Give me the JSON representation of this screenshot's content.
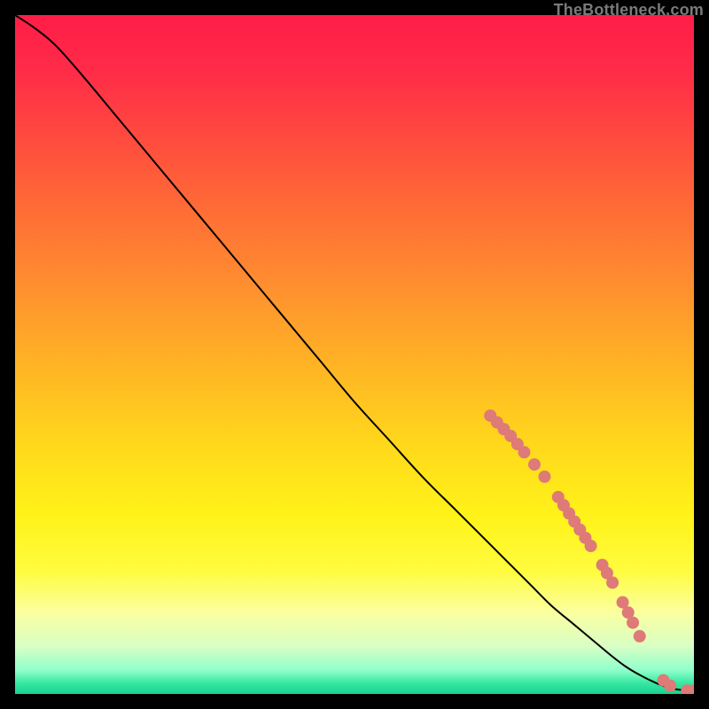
{
  "attribution": "TheBottleneck.com",
  "colors": {
    "gradient_stops": [
      {
        "offset": 0.0,
        "color": "#ff1d47"
      },
      {
        "offset": 0.08,
        "color": "#ff2b48"
      },
      {
        "offset": 0.18,
        "color": "#ff4a3f"
      },
      {
        "offset": 0.28,
        "color": "#ff6a36"
      },
      {
        "offset": 0.4,
        "color": "#ff8f2f"
      },
      {
        "offset": 0.52,
        "color": "#ffb524"
      },
      {
        "offset": 0.64,
        "color": "#ffda1b"
      },
      {
        "offset": 0.74,
        "color": "#fff31a"
      },
      {
        "offset": 0.82,
        "color": "#fffc40"
      },
      {
        "offset": 0.88,
        "color": "#fbffa0"
      },
      {
        "offset": 0.93,
        "color": "#d8ffc5"
      },
      {
        "offset": 0.965,
        "color": "#8fffca"
      },
      {
        "offset": 0.985,
        "color": "#33e7a0"
      },
      {
        "offset": 1.0,
        "color": "#1bd191"
      }
    ],
    "curve_stroke": "#000000",
    "marker_fill": "#de7a77",
    "marker_stroke": "#b35a58"
  },
  "chart_data": {
    "type": "line",
    "title": "",
    "xlabel": "",
    "ylabel": "",
    "xlim": [
      0,
      100
    ],
    "ylim": [
      0,
      100
    ],
    "grid": false,
    "legend": false,
    "series": [
      {
        "name": "curve",
        "x": [
          0,
          3,
          6,
          10,
          15,
          20,
          25,
          30,
          35,
          40,
          45,
          50,
          55,
          60,
          65,
          70,
          73,
          76,
          79,
          82,
          85,
          88,
          90,
          92,
          94,
          96,
          98,
          100
        ],
        "y": [
          100,
          98,
          95.5,
          91,
          85,
          79,
          73,
          67,
          61,
          55,
          49,
          43,
          37.5,
          32,
          27,
          22,
          19,
          16,
          13,
          10.5,
          8,
          5.5,
          4,
          2.8,
          1.8,
          1.0,
          0.6,
          0.5
        ]
      }
    ],
    "markers": [
      {
        "x": 70.0,
        "y": 41.0
      },
      {
        "x": 71.0,
        "y": 40.0
      },
      {
        "x": 72.0,
        "y": 39.0
      },
      {
        "x": 73.0,
        "y": 38.0
      },
      {
        "x": 74.0,
        "y": 36.8
      },
      {
        "x": 75.0,
        "y": 35.6
      },
      {
        "x": 76.5,
        "y": 33.8
      },
      {
        "x": 78.0,
        "y": 32.0
      },
      {
        "x": 80.0,
        "y": 29.0
      },
      {
        "x": 80.8,
        "y": 27.8
      },
      {
        "x": 81.6,
        "y": 26.6
      },
      {
        "x": 82.4,
        "y": 25.4
      },
      {
        "x": 83.2,
        "y": 24.2
      },
      {
        "x": 84.0,
        "y": 23.0
      },
      {
        "x": 84.8,
        "y": 21.8
      },
      {
        "x": 86.5,
        "y": 19.0
      },
      {
        "x": 87.2,
        "y": 17.8
      },
      {
        "x": 88.0,
        "y": 16.4
      },
      {
        "x": 89.5,
        "y": 13.5
      },
      {
        "x": 90.3,
        "y": 12.0
      },
      {
        "x": 91.0,
        "y": 10.5
      },
      {
        "x": 92.0,
        "y": 8.5
      },
      {
        "x": 95.5,
        "y": 2.0
      },
      {
        "x": 96.5,
        "y": 1.2
      },
      {
        "x": 99.0,
        "y": 0.5
      },
      {
        "x": 100.0,
        "y": 0.5
      }
    ],
    "marker_style": {
      "shape": "circle",
      "radius_px": 7
    }
  }
}
